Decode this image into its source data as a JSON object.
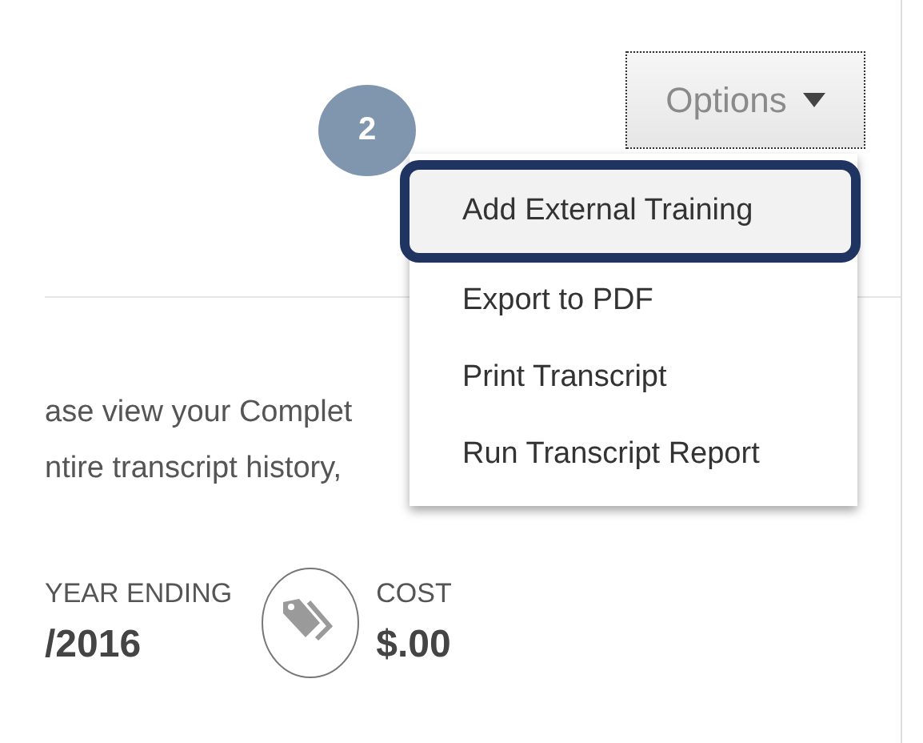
{
  "options_button": {
    "label": "Options"
  },
  "step_badge": "2",
  "menu": [
    {
      "label": "Add External Training",
      "selected": true
    },
    {
      "label": "Export to PDF",
      "selected": false
    },
    {
      "label": "Print Transcript",
      "selected": false
    },
    {
      "label": "Run Transcript Report",
      "selected": false
    }
  ],
  "intro_lines": [
    "ase view your Complet",
    "ntire transcript history,"
  ],
  "stats": [
    {
      "label": "YEAR ENDING",
      "value": "/2016",
      "kind": "plain"
    },
    {
      "label": "COST",
      "value": "$.00",
      "kind": "tag"
    }
  ]
}
